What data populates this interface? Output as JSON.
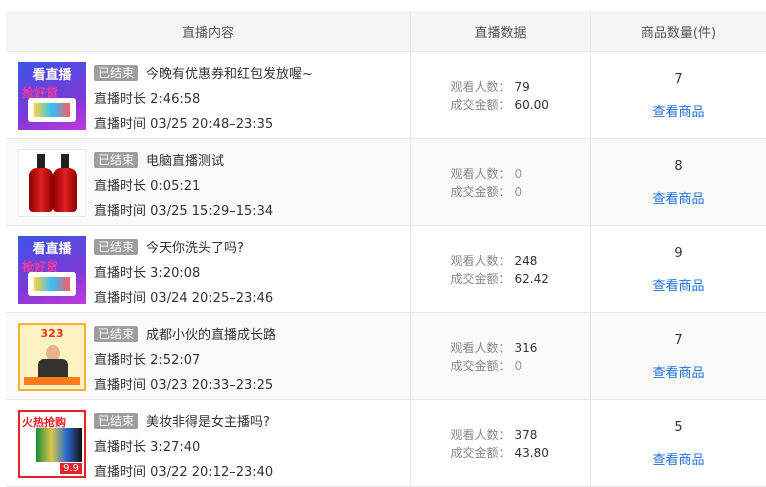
{
  "table": {
    "headers": {
      "content": "直播内容",
      "data": "直播数据",
      "count": "商品数量(件)"
    },
    "labels": {
      "duration": "直播时长",
      "time": "直播时间",
      "viewers": "观看人数：",
      "amount": "成交金额：",
      "view_products": "查看商品"
    },
    "rows": [
      {
        "thumb": "live-promo-thumbnail",
        "status": "已结束",
        "title": "今晚有优惠券和红包发放喔~",
        "duration": "2:46:58",
        "time": "03/25 20:48–23:35",
        "viewers": "79",
        "amount": "60.00",
        "count": "7",
        "thumb_top": "看直播",
        "thumb_mid": "抢好货"
      },
      {
        "thumb": "shampoo-bottles-thumbnail",
        "status": "已结束",
        "title": "电脑直播测试",
        "duration": "0:05:21",
        "time": "03/25 15:29–15:34",
        "viewers": "0",
        "amount": "0",
        "count": "8"
      },
      {
        "thumb": "live-promo-thumbnail",
        "status": "已结束",
        "title": "今天你洗头了吗?",
        "duration": "3:20:08",
        "time": "03/24 20:25–23:46",
        "viewers": "248",
        "amount": "62.42",
        "count": "9",
        "thumb_top": "看直播",
        "thumb_mid": "抢好货"
      },
      {
        "thumb": "streamer-promo-thumbnail",
        "status": "已结束",
        "title": "成都小伙的直播成长路",
        "duration": "2:52:07",
        "time": "03/23 20:33–23:25",
        "viewers": "316",
        "amount": "0",
        "count": "7",
        "thumb_top": "323"
      },
      {
        "thumb": "hot-sale-thumbnail",
        "status": "已结束",
        "title": "美妆非得是女主播吗?",
        "duration": "3:27:40",
        "time": "03/22 20:12–23:40",
        "viewers": "378",
        "amount": "43.80",
        "count": "5",
        "thumb_top": "火热抢购",
        "thumb_price": "9.9"
      }
    ]
  }
}
